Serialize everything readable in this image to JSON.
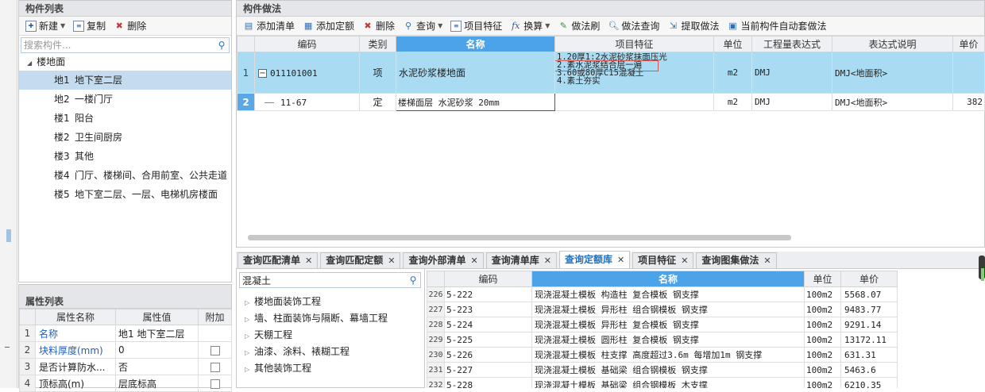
{
  "component_list": {
    "title": "构件列表",
    "toolbar": {
      "new": "新建",
      "copy": "复制",
      "delete": "删除"
    },
    "search_placeholder": "搜索构件...",
    "root": "楼地面",
    "items": [
      {
        "code": "地1",
        "name": "地下室二层"
      },
      {
        "code": "地2",
        "name": "一楼门厅"
      },
      {
        "code": "楼1",
        "name": "阳台"
      },
      {
        "code": "楼2",
        "name": "卫生间厨房"
      },
      {
        "code": "楼3",
        "name": "其他"
      },
      {
        "code": "楼4",
        "name": "门厅、楼梯间、合用前室、公共走道"
      },
      {
        "code": "楼5",
        "name": "地下室二层、一层、电梯机房楼面"
      }
    ]
  },
  "properties": {
    "title": "属性列表",
    "headers": [
      "属性名称",
      "属性值",
      "附加"
    ],
    "rows": [
      {
        "n": "1",
        "name": "名称",
        "value": "地1 地下室二层",
        "check": false
      },
      {
        "n": "2",
        "name": "块料厚度(mm)",
        "value": "0",
        "check": true
      },
      {
        "n": "3",
        "name": "是否计算防水...",
        "value": "否",
        "check": true
      },
      {
        "n": "4",
        "name": "顶标高(m)",
        "value": "层底标高",
        "check": true
      }
    ]
  },
  "method": {
    "title": "构件做法",
    "toolbar": {
      "add_list": "添加清单",
      "add_quota": "添加定额",
      "delete": "删除",
      "query": "查询",
      "feature": "项目特征",
      "convert": "换算",
      "brush": "做法刷",
      "method_query": "做法查询",
      "extract": "提取做法",
      "auto": "当前构件自动套做法"
    },
    "headers": [
      "编码",
      "类别",
      "名称",
      "项目特征",
      "单位",
      "工程量表达式",
      "表达式说明",
      "单价"
    ],
    "rows": [
      {
        "n": "1",
        "code": "011101001",
        "type": "项",
        "name": "水泥砂浆楼地面",
        "features": [
          "1.20厚1:2水泥砂浆抹面压光",
          "2.素水泥浆结合层一遍",
          "3.60或80厚C15混凝土",
          "4.素土夯实"
        ],
        "unit": "m2",
        "expr": "DMJ",
        "expr_desc": "DMJ<地面积>",
        "price": ""
      },
      {
        "n": "2",
        "code": "11-67",
        "type": "定",
        "name": "楼梯面层 水泥砂浆 20mm",
        "features": [],
        "unit": "m2",
        "expr": "DMJ",
        "expr_desc": "DMJ<地面积>",
        "price": "382"
      }
    ]
  },
  "tabs": [
    {
      "label": "查询匹配清单",
      "active": false
    },
    {
      "label": "查询匹配定额",
      "active": false
    },
    {
      "label": "查询外部清单",
      "active": false
    },
    {
      "label": "查询清单库",
      "active": false
    },
    {
      "label": "查询定额库",
      "active": true
    },
    {
      "label": "项目特征",
      "active": false
    },
    {
      "label": "查询图集做法",
      "active": false
    }
  ],
  "library": {
    "search_value": "混凝土",
    "categories": [
      "楼地面装饰工程",
      "墙、柱面装饰与隔断、幕墙工程",
      "天棚工程",
      "油漆、涂料、裱糊工程",
      "其他装饰工程"
    ]
  },
  "quota_table": {
    "headers": [
      "编码",
      "名称",
      "单位",
      "单价"
    ],
    "rows": [
      {
        "n": "226",
        "code": "5-222",
        "name": "现浇混凝土模板 构造柱 复合模板 钢支撑",
        "unit": "100m2",
        "price": "5568.07"
      },
      {
        "n": "227",
        "code": "5-223",
        "name": "现浇混凝土模板 异形柱 组合钢模板 钢支撑",
        "unit": "100m2",
        "price": "9483.77"
      },
      {
        "n": "228",
        "code": "5-224",
        "name": "现浇混凝土模板 异形柱 复合模板 钢支撑",
        "unit": "100m2",
        "price": "9291.14"
      },
      {
        "n": "229",
        "code": "5-225",
        "name": "现浇混凝土模板 圆形柱 复合模板 钢支撑",
        "unit": "100m2",
        "price": "13172.11"
      },
      {
        "n": "230",
        "code": "5-226",
        "name": "现浇混凝土模板 柱支撑 高度超过3.6m 每增加1m 钢支撑",
        "unit": "100m2",
        "price": "631.31"
      },
      {
        "n": "231",
        "code": "5-227",
        "name": "现浇混凝土模板 基础梁 组合钢模板 钢支撑",
        "unit": "100m2",
        "price": "5463.6"
      },
      {
        "n": "232",
        "code": "5-228",
        "name": "现浇混凝土模板 基础梁 组合钢模板 木支撑",
        "unit": "100m2",
        "price": "6210.35"
      }
    ]
  }
}
